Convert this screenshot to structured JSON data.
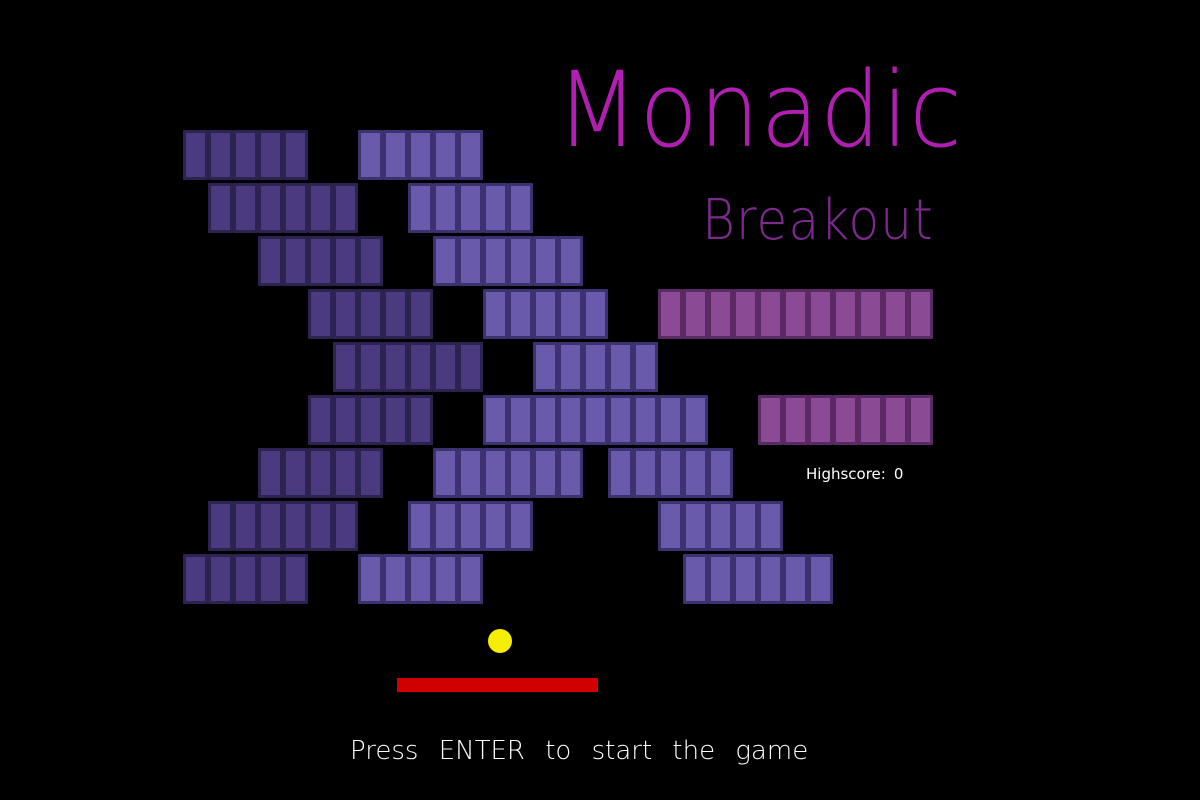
{
  "game": {
    "title": "Monadic",
    "subtitle": "Breakout",
    "highscore_label": "Highscore:",
    "highscore_value": "0",
    "prompt": "Press ENTER to start the game"
  },
  "colors": {
    "background": "#000000",
    "title": "#b01fb2",
    "subtitle": "#7d2a8e",
    "ball": "#f5ee00",
    "paddle": "#d10000",
    "text": "#ffffff"
  },
  "bricks": {
    "dark_fill": "#4b3a80",
    "dark_border": "#2c2350",
    "light_fill": "#6a5aac",
    "light_border": "#3c3270",
    "pink_fill": "#8b4a94",
    "pink_border": "#5b2a64"
  }
}
